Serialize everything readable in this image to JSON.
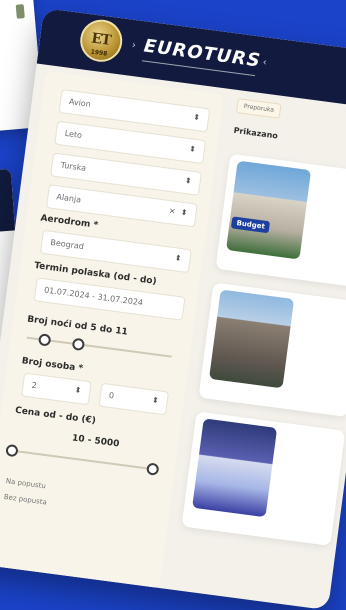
{
  "header": {
    "brand": "EUROTURS"
  },
  "logo": {
    "text": "ET",
    "year": "1998"
  },
  "filters": {
    "selects": [
      "Avion",
      "Leto",
      "Turska",
      "Alanja"
    ],
    "airport": {
      "label": "Aerodrom *",
      "value": "Beograd"
    },
    "term": {
      "label": "Termin polaska (od - do)",
      "value": "01.07.2024 - 31.07.2024"
    },
    "nights": {
      "label": "Broj noći od",
      "min": "5",
      "to": "do",
      "max": "11"
    },
    "persons": {
      "label": "Broj osoba *",
      "adults": "2",
      "children": "0"
    },
    "price": {
      "label": "Cena od - do (€)",
      "range": "10 - 5000"
    },
    "checks": [
      "Na popustu",
      "Bez popusta"
    ]
  },
  "results": {
    "sort_chip": "Preporuka",
    "label": "Prikazano",
    "badge": "Budget"
  },
  "colors": {
    "background": "#1b43c9",
    "header": "#121b3f",
    "panel": "#f3f1ea",
    "sidebar": "#f8f4e9"
  }
}
